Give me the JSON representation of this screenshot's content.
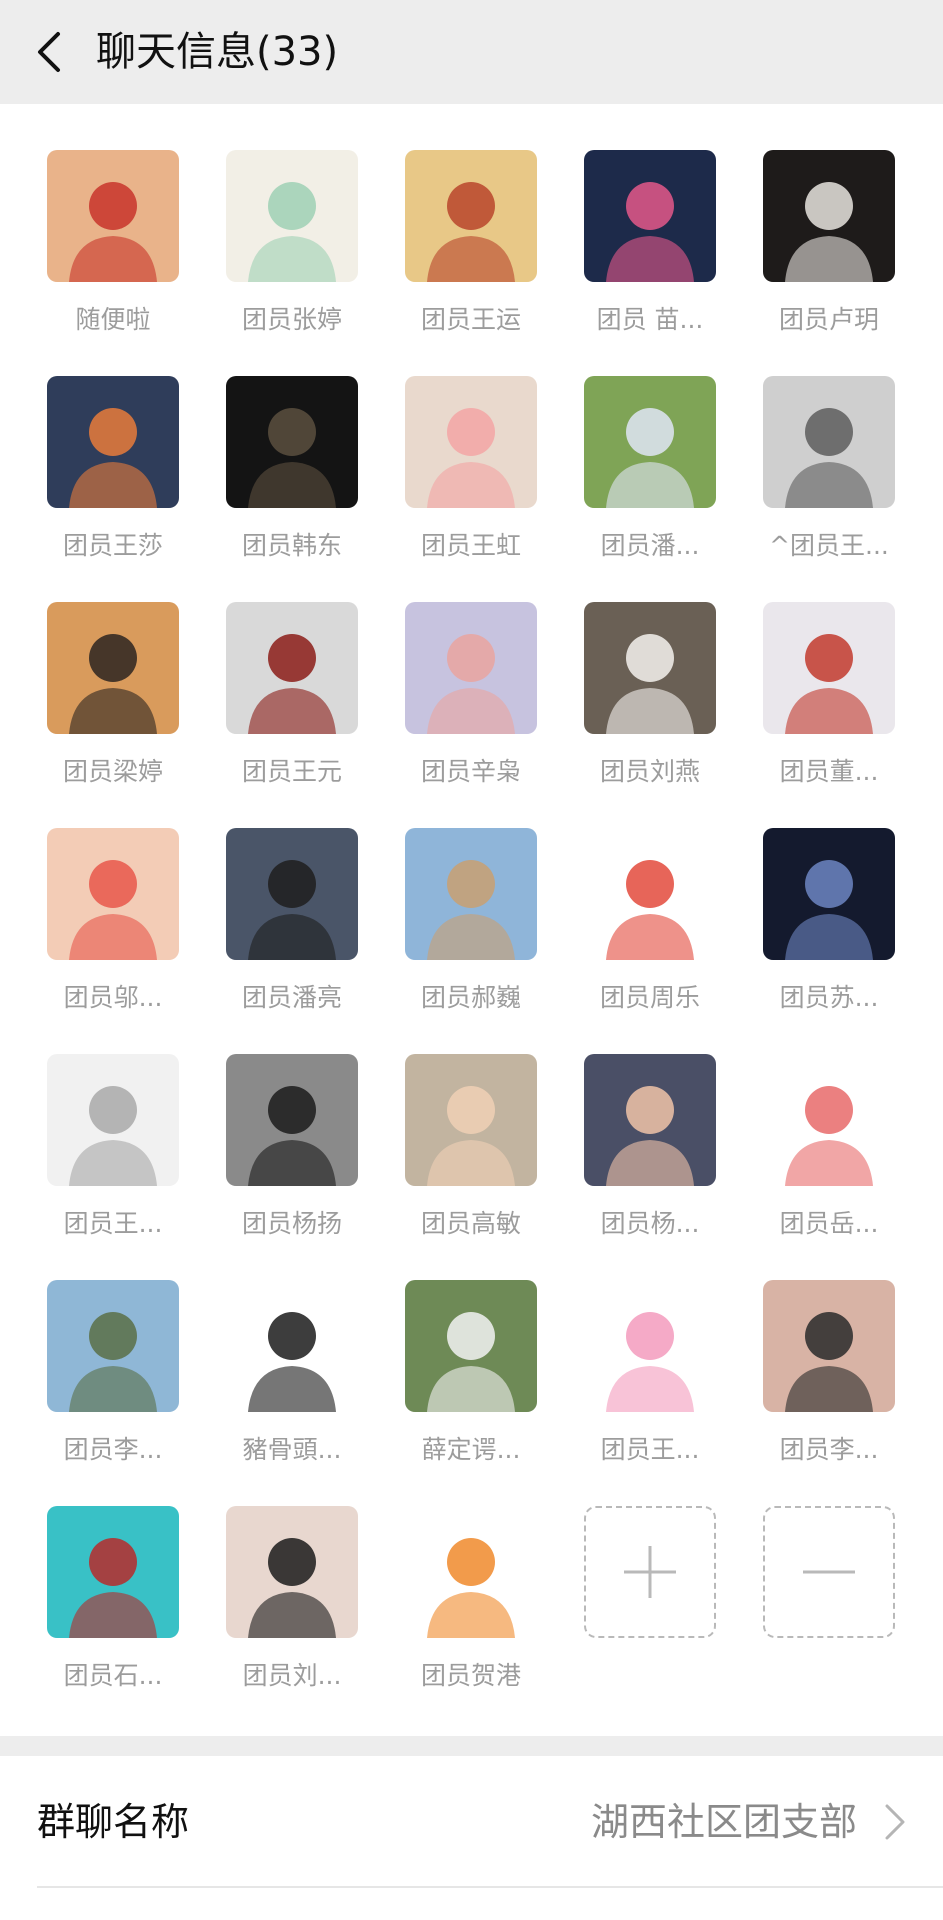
{
  "header": {
    "title": "聊天信息(33)"
  },
  "members": [
    {
      "name": "随便啦",
      "bg": "#e9b38a",
      "fg": "#c8342a"
    },
    {
      "name": "团员张婷",
      "bg": "#f2efe6",
      "fg": "#9fd0b4"
    },
    {
      "name": "团员王运",
      "bg": "#e8c887",
      "fg": "#b8452b"
    },
    {
      "name": "团员 苗...",
      "bg": "#1d2a4a",
      "fg": "#e4588a"
    },
    {
      "name": "团员卢玥",
      "bg": "#1e1b1a",
      "fg": "#e7e4df"
    },
    {
      "name": "团员王莎",
      "bg": "#2f3d5a",
      "fg": "#e77b3b"
    },
    {
      "name": "团员韩东",
      "bg": "#141414",
      "fg": "#5b4f3e"
    },
    {
      "name": "团员王虹",
      "bg": "#e9d9cd",
      "fg": "#f3a4a4"
    },
    {
      "name": "团员潘...",
      "bg": "#7fa456",
      "fg": "#dfe6f5"
    },
    {
      "name": "^团员王...",
      "bg": "#cfcfcf",
      "fg": "#5d5d5d"
    },
    {
      "name": "团员梁婷",
      "bg": "#d99b5c",
      "fg": "#2b2420"
    },
    {
      "name": "团员王元",
      "bg": "#d9d9d9",
      "fg": "#8b1c18"
    },
    {
      "name": "团员辛枭",
      "bg": "#c7c3df",
      "fg": "#e9a5a0"
    },
    {
      "name": "团员刘燕",
      "bg": "#6a6055",
      "fg": "#f5f2ee"
    },
    {
      "name": "团员董...",
      "bg": "#eae7ec",
      "fg": "#c23a2e"
    },
    {
      "name": "团员邬...",
      "bg": "#f3ccb6",
      "fg": "#e8574b"
    },
    {
      "name": "团员潘亮",
      "bg": "#4a5568",
      "fg": "#1e1e1e"
    },
    {
      "name": "团员郝巍",
      "bg": "#8fb5d9",
      "fg": "#c9a071"
    },
    {
      "name": "团员周乐",
      "bg": "#ffffff",
      "fg": "#e34a3c"
    },
    {
      "name": "团员苏...",
      "bg": "#141a2e",
      "fg": "#6c86c2"
    },
    {
      "name": "团员王...",
      "bg": "#f1f1f1",
      "fg": "#a9a9a9"
    },
    {
      "name": "团员杨扬",
      "bg": "#8a8a8a",
      "fg": "#1b1b1b"
    },
    {
      "name": "团员高敏",
      "bg": "#c2b4a0",
      "fg": "#f0d0b5"
    },
    {
      "name": "团员杨...",
      "bg": "#4a4f66",
      "fg": "#f0c3a8"
    },
    {
      "name": "团员岳...",
      "bg": "#ffffff",
      "fg": "#e76a6a"
    },
    {
      "name": "团员李...",
      "bg": "#8fb7d6",
      "fg": "#5a7046"
    },
    {
      "name": "豬骨頭...",
      "bg": "#ffffff",
      "fg": "#1b1b1b"
    },
    {
      "name": "薛定谔...",
      "bg": "#6e8a56",
      "fg": "#f2f2f2"
    },
    {
      "name": "团员王...",
      "bg": "#ffffff",
      "fg": "#f39bbd"
    },
    {
      "name": "团员李...",
      "bg": "#d8b3a5",
      "fg": "#2a2a2a"
    },
    {
      "name": "团员石...",
      "bg": "#39c1c6",
      "fg": "#b72a2a"
    },
    {
      "name": "团员刘...",
      "bg": "#e8d7cf",
      "fg": "#1b1b1b"
    },
    {
      "name": "团员贺港",
      "bg": "#ffffff",
      "fg": "#f08a2b"
    }
  ],
  "actions": {
    "add_icon": "plus-icon",
    "remove_icon": "minus-icon"
  },
  "settings": {
    "group_name_label": "群聊名称",
    "group_name_value": "湖西社区团支部"
  },
  "colors": {
    "header_bg": "#ededed",
    "name_gray": "#9c9c9c"
  }
}
